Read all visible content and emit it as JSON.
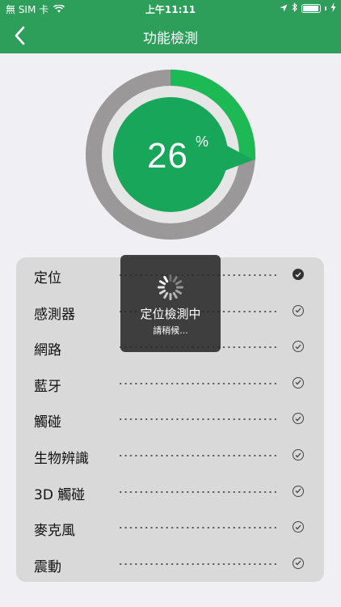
{
  "status_bar": {
    "carrier": "無 SIM 卡",
    "time": "上午11:11",
    "battery_level": 0.95
  },
  "nav": {
    "title": "功能檢測",
    "back_icon": "chevron-left-icon"
  },
  "progress": {
    "value": 26,
    "display": "26",
    "unit": "%"
  },
  "checklist": [
    {
      "label": "定位",
      "done": true
    },
    {
      "label": "感測器",
      "done": false
    },
    {
      "label": "網路",
      "done": false
    },
    {
      "label": "藍牙",
      "done": false
    },
    {
      "label": "觸碰",
      "done": false
    },
    {
      "label": "生物辨識",
      "done": false
    },
    {
      "label": "3D 觸碰",
      "done": false
    },
    {
      "label": "麥克風",
      "done": false
    },
    {
      "label": "震動",
      "done": false
    }
  ],
  "hud": {
    "title": "定位檢測中",
    "subtitle": "請稍候..."
  },
  "colors": {
    "header": "#2e9e5b",
    "progress_green": "#1db954",
    "inner_green": "#17a65a",
    "ring_gray": "#9a9898"
  }
}
